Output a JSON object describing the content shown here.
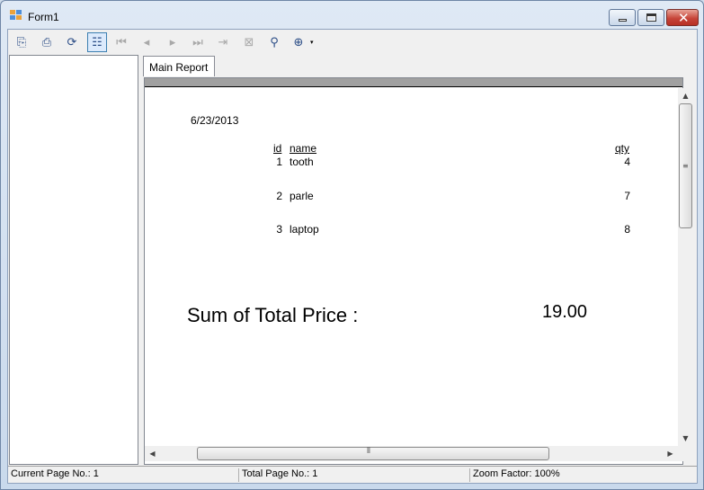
{
  "window": {
    "title": "Form1",
    "icon": "app-windows-icon"
  },
  "toolbar": {
    "buttons": [
      {
        "name": "export-report-icon",
        "glyph": "⎘",
        "enabled": true
      },
      {
        "name": "print-report-icon",
        "glyph": "⎙",
        "enabled": true
      },
      {
        "name": "refresh-icon",
        "glyph": "⟳",
        "enabled": true
      },
      {
        "name": "toggle-group-tree-icon",
        "glyph": "☷",
        "enabled": true,
        "active": true
      },
      {
        "name": "first-page-icon",
        "glyph": "⏮",
        "enabled": false
      },
      {
        "name": "previous-page-icon",
        "glyph": "◂",
        "enabled": false
      },
      {
        "name": "next-page-icon",
        "glyph": "▸",
        "enabled": false
      },
      {
        "name": "last-page-icon",
        "glyph": "⏭",
        "enabled": false
      },
      {
        "name": "goto-page-icon",
        "glyph": "⇥",
        "enabled": false
      },
      {
        "name": "stop-loading-icon",
        "glyph": "⊠",
        "enabled": false
      },
      {
        "name": "find-binoculars-icon",
        "glyph": "⚲",
        "enabled": true
      },
      {
        "name": "zoom-icon",
        "glyph": "⊕",
        "enabled": true
      }
    ],
    "zoom_caret": "▾"
  },
  "tabs": [
    {
      "label": "Main Report"
    }
  ],
  "report": {
    "date": "6/23/2013",
    "columns": {
      "id": "id",
      "name": "name",
      "qty": "qty"
    },
    "rows": [
      {
        "id": "1",
        "name": "tooth",
        "qty": "4"
      },
      {
        "id": "2",
        "name": "parle",
        "qty": "7"
      },
      {
        "id": "3",
        "name": "laptop",
        "qty": "8"
      }
    ],
    "sum_label": "Sum of Total Price :",
    "sum_value": "19.00"
  },
  "scrollbars": {
    "up_arrow": "▲",
    "down_arrow": "▼",
    "left_arrow": "◀",
    "right_arrow": "▶",
    "v_grip": "≡",
    "h_grip": "⦀"
  },
  "status": {
    "current_page": "Current Page No.: 1",
    "total_page": "Total Page No.: 1",
    "zoom_factor": "Zoom Factor: 100%"
  }
}
